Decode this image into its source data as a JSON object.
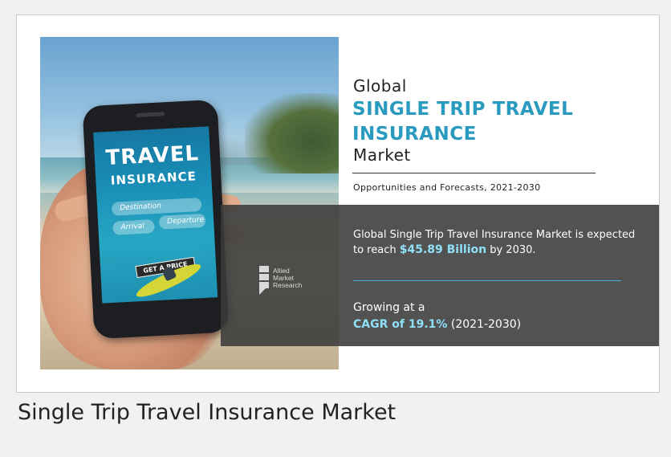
{
  "caption": "Single Trip Travel Insurance Market",
  "infographic": {
    "heading_global": "Global",
    "title_line1": "SINGLE TRIP TRAVEL",
    "title_line2": "INSURANCE",
    "heading_market": "Market",
    "subtitle": "Opportunities and Forecasts, 2021-2030",
    "stat_prefix": "Global Single Trip Travel Insurance Market is expected to reach",
    "stat_value": "$45.89 Billion",
    "stat_suffix": "by 2030.",
    "growing_label": "Growing at a",
    "cagr_value": "CAGR of 19.1%",
    "cagr_period": "(2021-2030)",
    "logo_lines": [
      "Allied",
      "Market",
      "Research"
    ],
    "accent_color": "#2a9bbf",
    "highlight_color": "#8fe0f7"
  },
  "phone_screen": {
    "title": "TRAVEL",
    "subtitle": "INSURANCE",
    "field_destination": "Destination",
    "field_arrival": "Arrival",
    "field_departure": "Departure",
    "button": "GET A PRICE"
  }
}
